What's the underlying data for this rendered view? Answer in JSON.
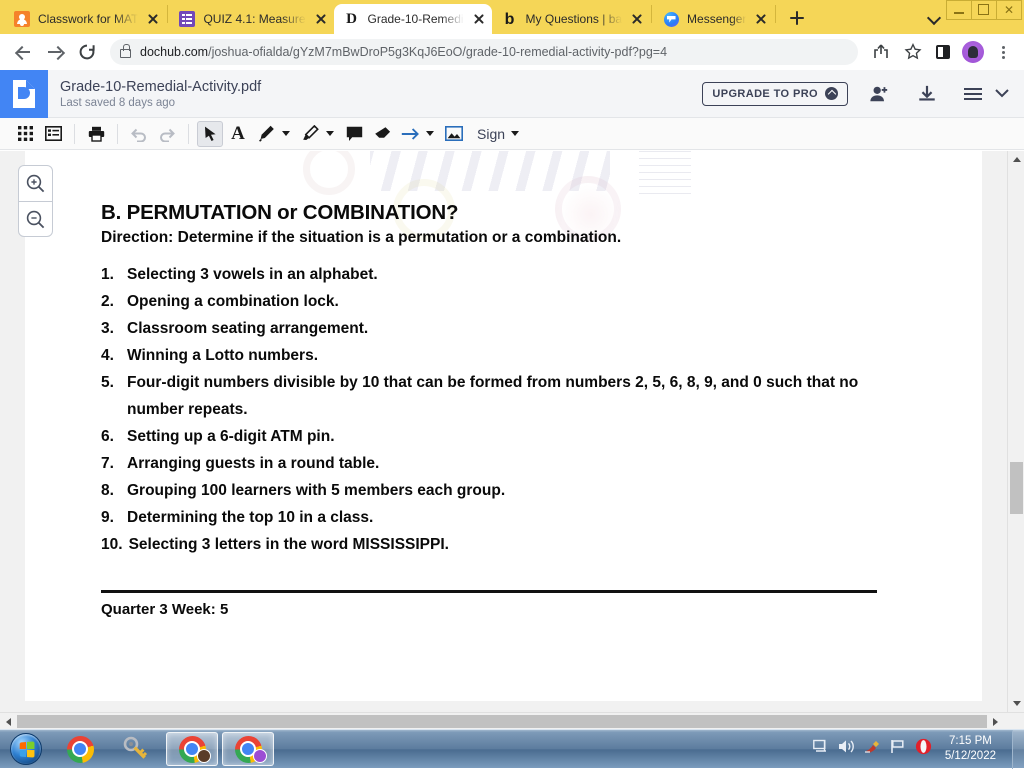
{
  "browser": {
    "tabs": [
      {
        "title": "Classwork for MAT",
        "favicon": "classroom-icon",
        "active": false
      },
      {
        "title": "QUIZ 4.1: Measure",
        "favicon": "google-forms-icon",
        "active": false
      },
      {
        "title": "Grade-10-Remedi",
        "favicon": "dochub-icon",
        "active": true
      },
      {
        "title": "My Questions | ba",
        "favicon": "brainly-icon",
        "active": false
      },
      {
        "title": "Messenger",
        "favicon": "messenger-icon",
        "active": false
      }
    ],
    "newtab_label": "+",
    "url_prefix": "dochub.com",
    "url_path": "/joshua-ofialda/gYzM7mBwDroP5g3KqJ6EoO/grade-10-remedial-activity-pdf?pg=4",
    "theme_color": "#f5d657"
  },
  "app": {
    "title": "Grade-10-Remedial-Activity.pdf",
    "subtitle": "Last saved 8 days ago",
    "upgrade_label": "UPGRADE TO PRO",
    "logo_letter": "D",
    "brand_color": "#4285f4",
    "toolbar": [
      {
        "name": "grid-view-icon",
        "label": ""
      },
      {
        "name": "page-list-icon",
        "label": ""
      },
      {
        "name": "print-icon",
        "label": ""
      },
      {
        "name": "undo-icon",
        "label": ""
      },
      {
        "name": "redo-icon",
        "label": ""
      },
      {
        "name": "pointer-icon",
        "label": ""
      },
      {
        "name": "text-icon",
        "label": "A"
      },
      {
        "name": "pen-icon",
        "label": ""
      },
      {
        "name": "highlighter-icon",
        "label": ""
      },
      {
        "name": "comment-icon",
        "label": ""
      },
      {
        "name": "eraser-icon",
        "label": ""
      },
      {
        "name": "arrow-icon",
        "label": ""
      },
      {
        "name": "image-icon",
        "label": ""
      }
    ],
    "sign_label": "Sign",
    "zoom_in_label": "zoom-in",
    "zoom_out_label": "zoom-out"
  },
  "document": {
    "heading": "B. PERMUTATION or COMBINATION?",
    "direction": "Direction: Determine if the situation is a permutation or a combination.",
    "items": [
      {
        "n": "1.",
        "text": "Selecting 3 vowels in an alphabet."
      },
      {
        "n": "2.",
        "text": "Opening a combination lock."
      },
      {
        "n": "3.",
        "text": "Classroom seating arrangement."
      },
      {
        "n": "4.",
        "text": "Winning a Lotto numbers."
      },
      {
        "n": "5.",
        "text": "Four-digit numbers divisible by 10 that can be formed from numbers 2, 5, 6, 8, 9, and 0 such that no number repeats."
      },
      {
        "n": "6.",
        "text": "Setting up a 6-digit ATM pin."
      },
      {
        "n": "7.",
        "text": "Arranging guests in a round table."
      },
      {
        "n": "8.",
        "text": "Grouping 100 learners with 5 members each group."
      },
      {
        "n": "9.",
        "text": "Determining the top 10 in a class."
      },
      {
        "n": "10.",
        "text": "Selecting 3 letters in the word MISSISSIPPI."
      }
    ],
    "footer": "Quarter 3 Week: 5"
  },
  "taskbar": {
    "start_label": "start-orb",
    "items": [
      {
        "name": "chrome-taskbar-icon",
        "open": false,
        "avatar": "none"
      },
      {
        "name": "keepass-key-icon",
        "open": false,
        "avatar": "none"
      },
      {
        "name": "chrome-window-1",
        "open": true,
        "avatar": "dark"
      },
      {
        "name": "chrome-window-2",
        "open": true,
        "avatar": "purple"
      }
    ],
    "tray": [
      "network-icon",
      "volume-icon",
      "ccleaner-icon",
      "action-center-flag-icon",
      "opera-icon"
    ],
    "time": "7:15 PM",
    "date": "5/12/2022"
  }
}
